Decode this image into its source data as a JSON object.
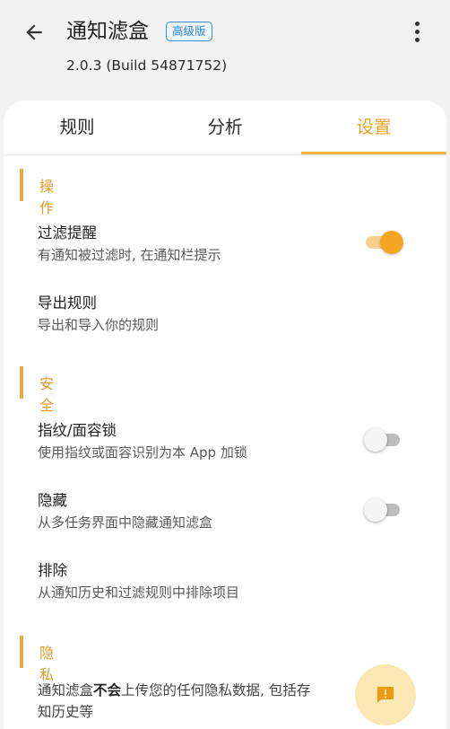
{
  "header": {
    "title": "通知滤盒",
    "badge": "高级版",
    "version": "2.0.3  (Build 54871752)"
  },
  "tabs": [
    {
      "label": "规则",
      "active": false
    },
    {
      "label": "分析",
      "active": false
    },
    {
      "label": "设置",
      "active": true
    }
  ],
  "sections": [
    {
      "title": "操作"
    },
    {
      "title": "安全"
    },
    {
      "title": "隐私"
    }
  ],
  "items": [
    {
      "title": "过滤提醒",
      "subtitle": "有通知被过滤时, 在通知栏提示",
      "toggle": true
    },
    {
      "title": "导出规则",
      "subtitle": "导出和导入你的规则"
    },
    {
      "title": "指纹/面容锁",
      "subtitle": "使用指纹或面容识别为本 App 加锁",
      "toggle": false
    },
    {
      "title": "隐藏",
      "subtitle": "从多任务界面中隐藏通知滤盒",
      "toggle": false
    },
    {
      "title": "排除",
      "subtitle": "从通知历史和过滤规则中排除项目"
    }
  ],
  "privacy": {
    "prefix": "通知滤盒",
    "emphasis": "不会",
    "suffix": "上传您的任何隐私数据, 包括存",
    "line2": "知历史等"
  },
  "colors": {
    "accent": "#f0b03a",
    "badge": "#2f86d4",
    "fab_bg": "#fbe7b4"
  },
  "icons": [
    "back-arrow-icon",
    "more-vert-icon",
    "feedback-icon"
  ]
}
